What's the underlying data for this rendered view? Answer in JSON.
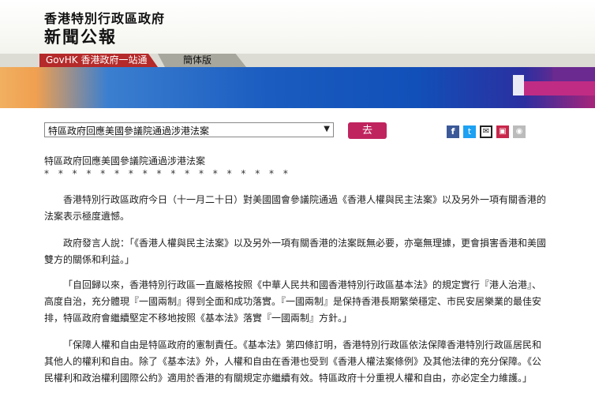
{
  "header": {
    "gov_name": "香港特別行政區政府",
    "site_title": "新聞公報"
  },
  "nav": {
    "govhk": "GovHK 香港政府一站通",
    "simplified": "簡体版"
  },
  "selector": {
    "value": "特區政府回應美國參議院通過涉港法案",
    "go_label": "去"
  },
  "share_icons": [
    "facebook-icon",
    "twitter-icon",
    "email-icon",
    "print-icon",
    "rss-icon"
  ],
  "article": {
    "subtitle": "特區政府回應美國參議院通過涉港法案",
    "stars": "* * * * * * * * * * * * * * * * * *",
    "paragraphs": [
      "香港特別行政區政府今日（十一月二十日）對美國國會參議院通過《香港人權與民主法案》以及另外一項有關香港的法案表示極度遺憾。",
      "政府發言人說：「《香港人權與民主法案》以及另外一項有關香港的法案既無必要，亦毫無理據，更會損害香港和美國雙方的關係和利益。」",
      "「自回歸以來，香港特別行政區一直嚴格按照《中華人民共和國香港特別行政區基本法》的規定實行『港人治港』、高度自治，充分體現『一國兩制』得到全面和成功落實。『一國兩制』是保持香港長期繁榮穩定、市民安居樂業的最佳安排，特區政府會繼續堅定不移地按照《基本法》落實『一國兩制』方針。」",
      "「保障人權和自由是特區政府的憲制責任。《基本法》第四條訂明，香港特別行政區依法保障香港特別行政區居民和其他人的權利和自由。除了《基本法》外，人權和自由在香港也受到《香港人權法案條例》及其他法律的充分保障。《公民權利和政治權利國際公約》適用於香港的有關規定亦繼續有效。特區政府十分重視人權和自由，亦必定全力維護。」"
    ]
  }
}
